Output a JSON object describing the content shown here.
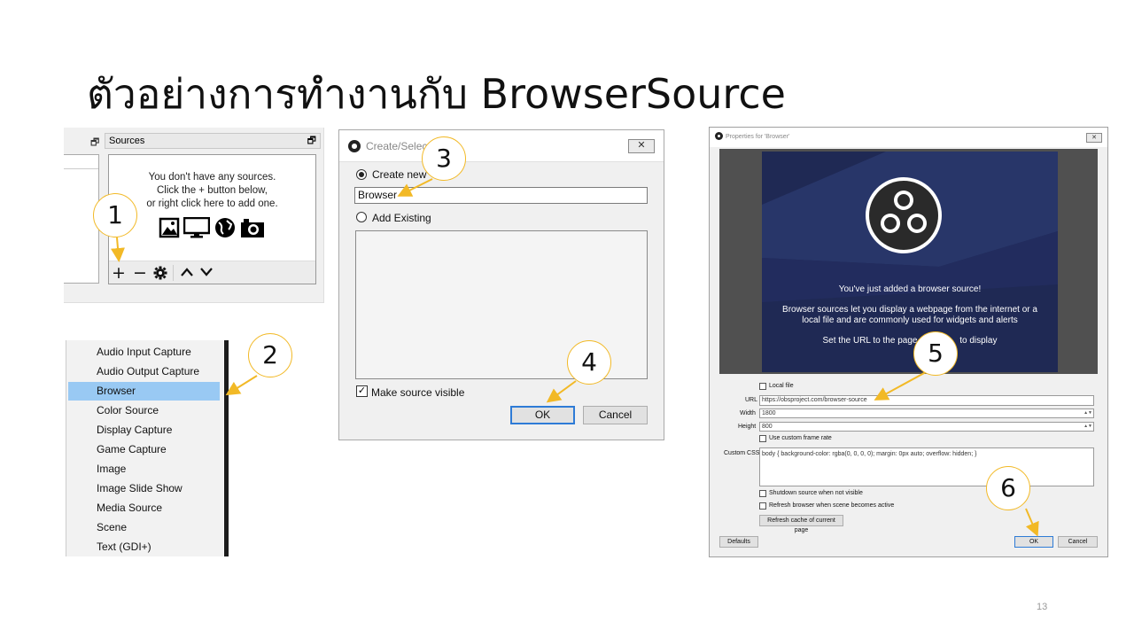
{
  "slide": {
    "title": "ตัวอย่างการทำงานกับ BrowserSource",
    "page_number": "13",
    "accent_color": "#f2b926"
  },
  "sources_dock": {
    "header": "Sources",
    "float_icon": "restore-window-icon",
    "empty_message_lines": [
      "You don't have any sources.",
      "Click the + button below,",
      "or right click here to add one."
    ],
    "type_icons": [
      "image-icon",
      "monitor-icon",
      "globe-icon",
      "camera-icon"
    ],
    "toolbar": {
      "add": "+",
      "remove": "−",
      "settings": "gear-icon",
      "up": "∧",
      "down": "∨"
    }
  },
  "add_menu": {
    "items": [
      "Audio Input Capture",
      "Audio Output Capture",
      "Browser",
      "Color Source",
      "Display Capture",
      "Game Capture",
      "Image",
      "Image Slide Show",
      "Media Source",
      "Scene",
      "Text (GDI+)"
    ],
    "selected": "Browser",
    "highlight_color": "#99c9f3"
  },
  "create_dialog": {
    "title": "Create/Select",
    "close": "✕",
    "create_new_label": "Create new",
    "name_value": "Browser",
    "add_existing_label": "Add Existing",
    "make_visible_label": "Make source visible",
    "make_visible_checked": true,
    "ok_label": "OK",
    "cancel_label": "Cancel"
  },
  "properties": {
    "title": "Properties for 'Browser'",
    "close": "✕",
    "preview": {
      "line1": "You've just added a browser source!",
      "line2a": "Browser sources let you display a webpage from the internet or a",
      "line2b": "local file and are commonly used for widgets and alerts",
      "line3a": "Set the URL to the page y",
      "line3b": "to display",
      "background_color": "#1f2954"
    },
    "local_file_label": "Local file",
    "url_label": "URL",
    "url_value": "https://obsproject.com/browser-source",
    "width_label": "Width",
    "width_value": "1800",
    "height_label": "Height",
    "height_value": "800",
    "custom_frame_rate_label": "Use custom frame rate",
    "custom_css_label": "Custom CSS",
    "custom_css_value": "body { background-color: rgba(0, 0, 0, 0); margin: 0px auto; overflow: hidden; }",
    "shutdown_label": "Shutdown source when not visible",
    "refresh_label": "Refresh browser when scene becomes active",
    "refresh_cache_label": "Refresh cache of current page",
    "defaults_label": "Defaults",
    "ok_label": "OK",
    "cancel_label": "Cancel"
  },
  "callouts": [
    "1",
    "2",
    "3",
    "4",
    "5",
    "6"
  ]
}
